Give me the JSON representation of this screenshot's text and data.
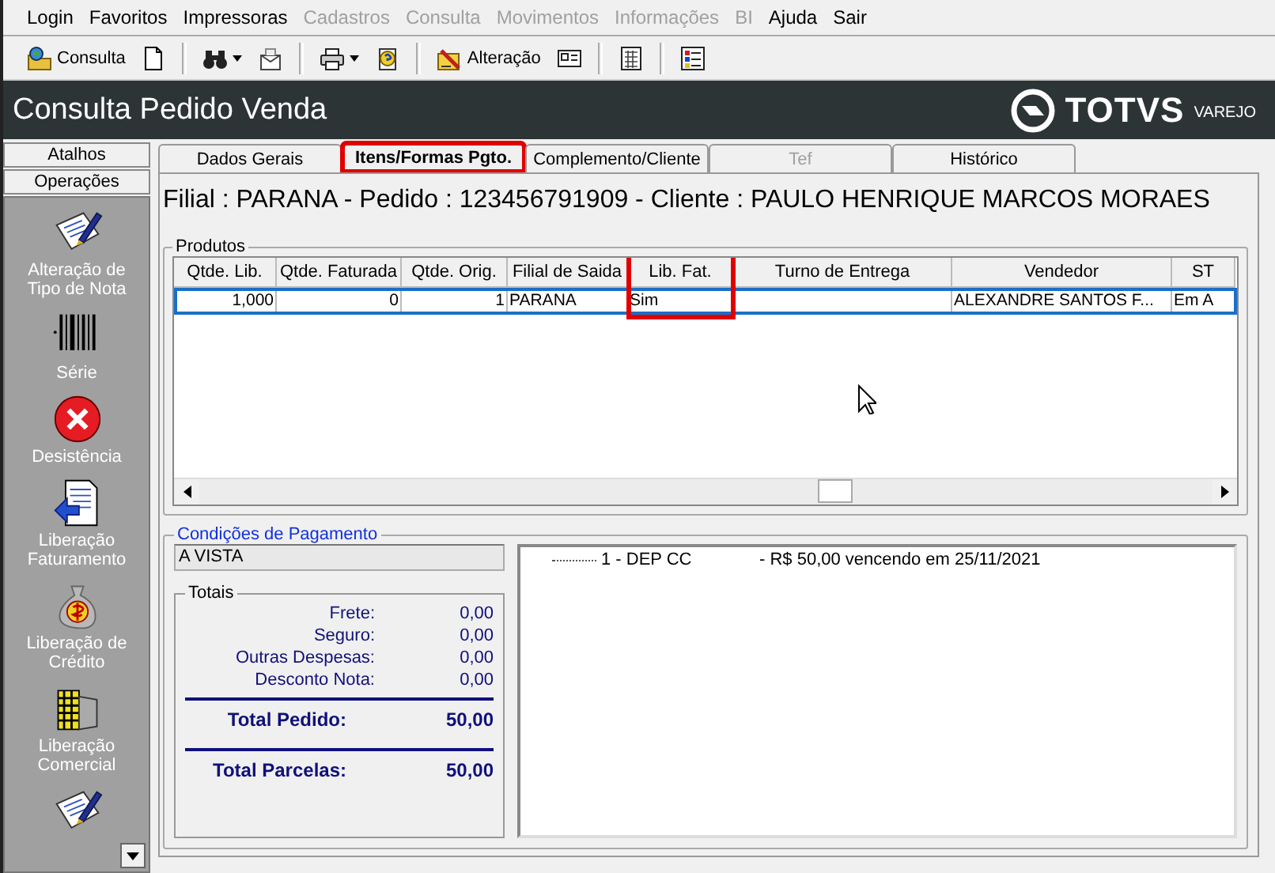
{
  "menu": [
    {
      "label": "Login",
      "disabled": false
    },
    {
      "label": "Favoritos",
      "disabled": false
    },
    {
      "label": "Impressoras",
      "disabled": false
    },
    {
      "label": "Cadastros",
      "disabled": true
    },
    {
      "label": "Consulta",
      "disabled": true
    },
    {
      "label": "Movimentos",
      "disabled": true
    },
    {
      "label": "Informações",
      "disabled": true
    },
    {
      "label": "BI",
      "disabled": true
    },
    {
      "label": "Ajuda",
      "disabled": false
    },
    {
      "label": "Sair",
      "disabled": false
    }
  ],
  "toolbar": [
    {
      "kind": "consult",
      "label": "Consulta"
    },
    {
      "kind": "page"
    },
    {
      "kind": "binoculars",
      "separator_before": true,
      "dropdown": true
    },
    {
      "kind": "envelope"
    },
    {
      "kind": "printer",
      "separator_before": true,
      "dropdown": true
    },
    {
      "kind": "help"
    },
    {
      "kind": "edit",
      "separator_before": true,
      "label": "Alteração"
    },
    {
      "kind": "card"
    },
    {
      "kind": "calendar",
      "separator_before": true
    },
    {
      "kind": "list",
      "separator_before": true
    }
  ],
  "window": {
    "title": "Consulta Pedido Venda"
  },
  "logo": {
    "name": "TOTVS",
    "tagline": "VAREJO"
  },
  "sidebar": {
    "buttons": [
      "Atalhos",
      "Operações"
    ],
    "items": [
      {
        "kind": "note",
        "label": "Alteração de Tipo de Nota"
      },
      {
        "kind": "barcode",
        "label": "Série"
      },
      {
        "kind": "cancel",
        "label": "Desistência"
      },
      {
        "kind": "document",
        "label": "Liberação Faturamento"
      },
      {
        "kind": "moneybag",
        "label": "Liberação de Crédito"
      },
      {
        "kind": "stack",
        "label": "Liberação Comercial"
      },
      {
        "kind": "note"
      }
    ]
  },
  "tabs": [
    {
      "label": "Dados Gerais",
      "selected": false,
      "disabled": false,
      "highlighted": false
    },
    {
      "label": "Itens/Formas Pgto.",
      "selected": true,
      "disabled": false,
      "highlighted": true
    },
    {
      "label": "Complemento/Cliente",
      "selected": false,
      "disabled": false,
      "highlighted": false
    },
    {
      "label": "Tef",
      "selected": false,
      "disabled": true,
      "highlighted": false
    },
    {
      "label": "Histórico",
      "selected": false,
      "disabled": false,
      "highlighted": false
    }
  ],
  "header": "Filial : PARANA - Pedido : 123456791909 -  Cliente : PAULO HENRIQUE MARCOS MORAES",
  "products": {
    "title": "Produtos",
    "columns": [
      {
        "label": "Qtde. Lib.",
        "kind": "number",
        "highlighted": false
      },
      {
        "label": "Qtde. Faturada",
        "kind": "number",
        "highlighted": false
      },
      {
        "label": "Qtde. Orig.",
        "kind": "number",
        "highlighted": false
      },
      {
        "label": "Filial de Saida",
        "kind": "text",
        "highlighted": false
      },
      {
        "label": "Lib. Fat.",
        "kind": "text",
        "highlighted": true
      },
      {
        "label": "Turno de Entrega",
        "kind": "text",
        "highlighted": false
      },
      {
        "label": "Vendedor",
        "kind": "text",
        "highlighted": false
      },
      {
        "label": "ST",
        "kind": "text",
        "highlighted": false
      }
    ],
    "rows": [
      {
        "selected": true,
        "cells": [
          "1,000",
          "0",
          "1",
          "PARANA",
          "Sim",
          null,
          "ALEXANDRE SANTOS F...",
          "Em A"
        ]
      }
    ]
  },
  "payment": {
    "title": "Condições de Pagamento",
    "condition": "A VISTA",
    "totals": {
      "title": "Totais",
      "lines": [
        {
          "kind": "normal",
          "label": "Frete:",
          "value": "0,00"
        },
        {
          "kind": "normal",
          "label": "Seguro:",
          "value": "0,00"
        },
        {
          "kind": "normal",
          "label": "Outras Despesas:",
          "value": "0,00"
        },
        {
          "kind": "normal",
          "label": "Desconto Nota:",
          "value": "0,00"
        },
        {
          "kind": "total",
          "label": "Total Pedido:",
          "value": "50,00"
        },
        {
          "kind": "total",
          "label": "Total Parcelas:",
          "value": "50,00"
        }
      ]
    },
    "installments": [
      {
        "name": "1 - DEP CC",
        "detail": "- R$ 50,00 vencendo em  25/11/2021"
      }
    ]
  }
}
